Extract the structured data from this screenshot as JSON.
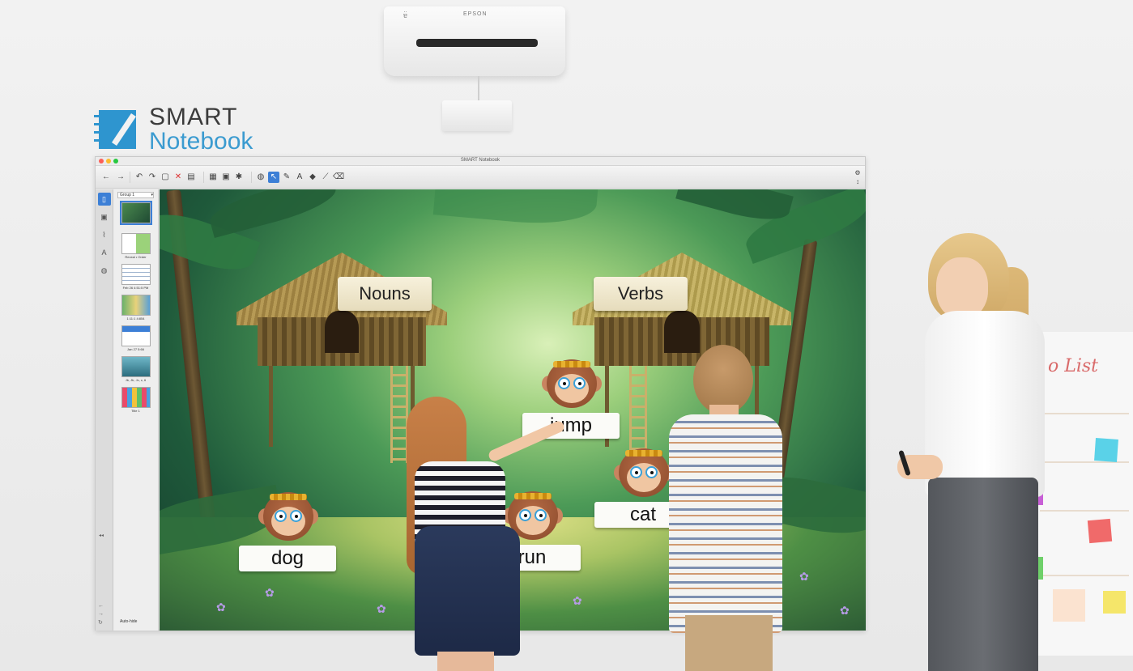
{
  "projector": {
    "brand": "EPSON"
  },
  "brand_logo": {
    "line1": "SMART",
    "line2": "Notebook",
    "accent_color": "#3b9bd0"
  },
  "window": {
    "title": "SMART Notebook",
    "toolbar": {
      "nav": [
        "arrow-left-icon",
        "arrow-right-icon"
      ],
      "tools": [
        "undo-icon",
        "redo-icon",
        "new-page-icon",
        "delete-icon",
        "screen-shade-icon",
        "table-icon",
        "pen-icon",
        "select-icon",
        "text-icon",
        "shape-icon",
        "fill-icon",
        "eraser-icon"
      ],
      "settings_icons": [
        "gear-icon",
        "expand-icon"
      ]
    },
    "side_tabs": [
      "page-sorter-icon",
      "gallery-icon",
      "attachments-icon",
      "properties-icon",
      "addons-icon"
    ],
    "sorter": {
      "group_label": "Group 1",
      "thumbs": [
        {
          "caption": "",
          "selected": true
        },
        {
          "caption": "Reveal • Order",
          "selected": false
        },
        {
          "caption": "Feb 26 4:51:5 PM",
          "selected": false
        },
        {
          "caption": "1:11:1 4:854",
          "selected": false
        },
        {
          "caption": "Jan 27 5:66",
          "selected": false
        },
        {
          "caption": "Jb, Jb, Jc, c, 6",
          "selected": false
        },
        {
          "caption": "Title 1",
          "selected": false
        }
      ],
      "auto_hide": "Auto-hide"
    },
    "lesson": {
      "huts": [
        {
          "label": "Nouns"
        },
        {
          "label": "Verbs"
        }
      ],
      "monkeys": [
        {
          "word": "jump"
        },
        {
          "word": "cat"
        },
        {
          "word": "dog"
        },
        {
          "word": "run"
        }
      ]
    }
  },
  "wall": {
    "heading": "o List"
  },
  "colors": {
    "toolbar_selected": "#3c7fd6",
    "jungle_dark": "#143a2b",
    "sign_bg": "#f7f1dc"
  }
}
